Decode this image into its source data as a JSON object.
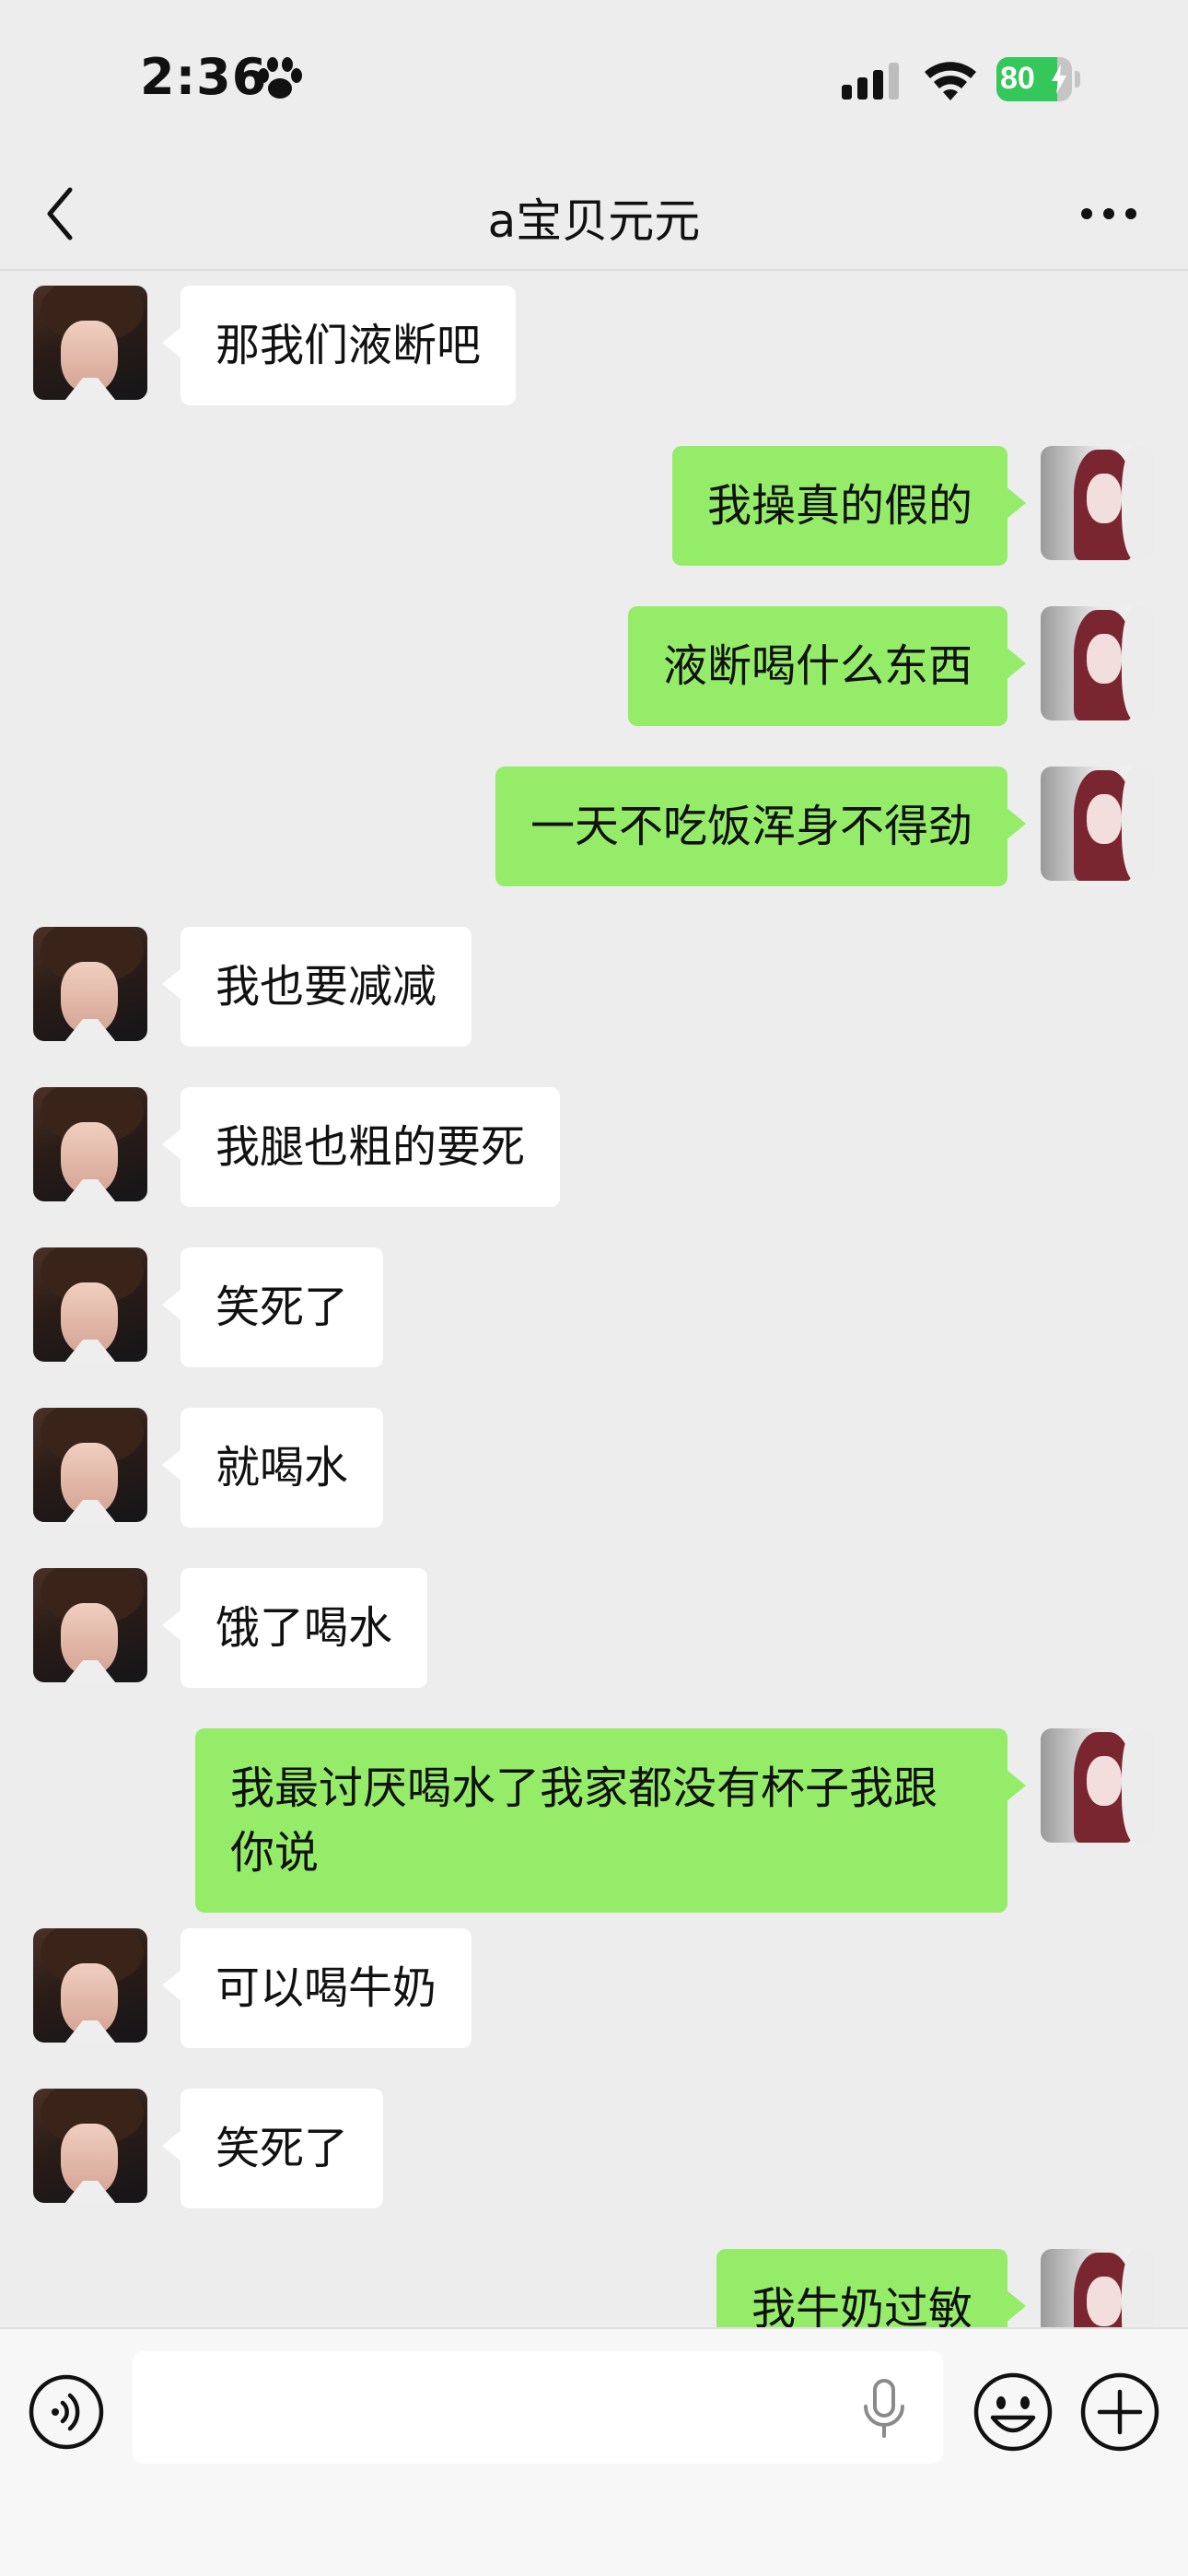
{
  "status_bar": {
    "time": "2:36",
    "battery_percent": "80",
    "battery_level": 0.8
  },
  "nav": {
    "title": "a宝贝元元",
    "back_icon": "chevron-left-icon",
    "more_icon": "more-dots-icon"
  },
  "messages": [
    {
      "side": "in",
      "text": "那我们液断吧"
    },
    {
      "side": "out",
      "text": "我操真的假的"
    },
    {
      "side": "out",
      "text": "液断喝什么东西"
    },
    {
      "side": "out",
      "text": "一天不吃饭浑身不得劲"
    },
    {
      "side": "in",
      "text": "我也要减减"
    },
    {
      "side": "in",
      "text": "我腿也粗的要死"
    },
    {
      "side": "in",
      "text": "笑死了"
    },
    {
      "side": "in",
      "text": "就喝水"
    },
    {
      "side": "in",
      "text": "饿了喝水"
    },
    {
      "side": "out",
      "text": "我最讨厌喝水了我家都没有杯子我跟你说"
    },
    {
      "side": "in",
      "text": "可以喝牛奶"
    },
    {
      "side": "in",
      "text": "笑死了"
    },
    {
      "side": "out",
      "text": "我牛奶过敏"
    }
  ],
  "input_bar": {
    "placeholder": "",
    "icons": [
      "voice-icon",
      "mic-icon",
      "emoji-icon",
      "plus-icon"
    ]
  },
  "colors": {
    "background": "#ededed",
    "bubble_out": "#95ec69",
    "bubble_in": "#ffffff",
    "battery": "#34c759"
  }
}
